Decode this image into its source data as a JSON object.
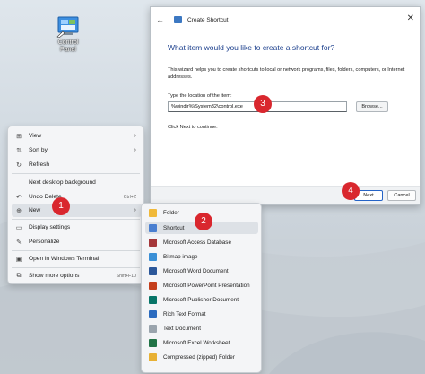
{
  "desktop": {
    "icon_label": "Control Panel"
  },
  "dialog": {
    "back_glyph": "←",
    "title": "Create Shortcut",
    "close_glyph": "✕",
    "heading": "What item would you like to create a shortcut for?",
    "description": "This wizard helps you to create shortcuts to local or network programs, files, folders, computers, or Internet addresses.",
    "location_label": "Type the location of the item:",
    "location_value": "%windir%\\System32\\control.exe",
    "browse_label": "Browse...",
    "hint": "Click Next to continue.",
    "next_label": "Next",
    "cancel_label": "Cancel"
  },
  "context_menu": {
    "items": [
      {
        "label": "View",
        "icon": "grid-icon",
        "glyph": "⊞",
        "arrow": "›"
      },
      {
        "label": "Sort by",
        "icon": "sort-icon",
        "glyph": "⇅",
        "arrow": "›"
      },
      {
        "label": "Refresh",
        "icon": "refresh-icon",
        "glyph": "↻"
      },
      {
        "label": "Next desktop background",
        "icon": "",
        "glyph": ""
      },
      {
        "label": "Undo Delete",
        "icon": "undo-icon",
        "glyph": "↶",
        "shortcut": "Ctrl+Z"
      },
      {
        "label": "New",
        "icon": "new-icon",
        "glyph": "⊕",
        "arrow": "›"
      },
      {
        "label": "Display settings",
        "icon": "display-icon",
        "glyph": "▭"
      },
      {
        "label": "Personalize",
        "icon": "brush-icon",
        "glyph": "✎"
      },
      {
        "label": "Open in Windows Terminal",
        "icon": "terminal-icon",
        "glyph": "▣"
      },
      {
        "label": "Show more options",
        "icon": "more-icon",
        "glyph": "⧉",
        "shortcut": "Shift+F10"
      }
    ]
  },
  "submenu": {
    "items": [
      {
        "label": "Folder",
        "icon": "folder-icon",
        "color": "#f0b93a"
      },
      {
        "label": "Shortcut",
        "icon": "shortcut-icon",
        "color": "#4a7fd0"
      },
      {
        "label": "Microsoft Access Database",
        "icon": "access-icon",
        "color": "#a4373a"
      },
      {
        "label": "Bitmap image",
        "icon": "bitmap-icon",
        "color": "#3a8fd6"
      },
      {
        "label": "Microsoft Word Document",
        "icon": "word-icon",
        "color": "#2b579a"
      },
      {
        "label": "Microsoft PowerPoint Presentation",
        "icon": "powerpoint-icon",
        "color": "#c43e1c"
      },
      {
        "label": "Microsoft Publisher Document",
        "icon": "publisher-icon",
        "color": "#077568"
      },
      {
        "label": "Rich Text Format",
        "icon": "rtf-icon",
        "color": "#2b6bbf"
      },
      {
        "label": "Text Document",
        "icon": "text-icon",
        "color": "#9aa4ad"
      },
      {
        "label": "Microsoft Excel Worksheet",
        "icon": "excel-icon",
        "color": "#217346"
      },
      {
        "label": "Compressed (zipped) Folder",
        "icon": "zip-folder-icon",
        "color": "#e8b134"
      }
    ]
  },
  "badges": {
    "step1": "1",
    "step2": "2",
    "step3": "3",
    "step4": "4"
  },
  "colors": {
    "badge": "#d9272e",
    "accent": "#2563c6",
    "heading": "#1a3e8c"
  }
}
